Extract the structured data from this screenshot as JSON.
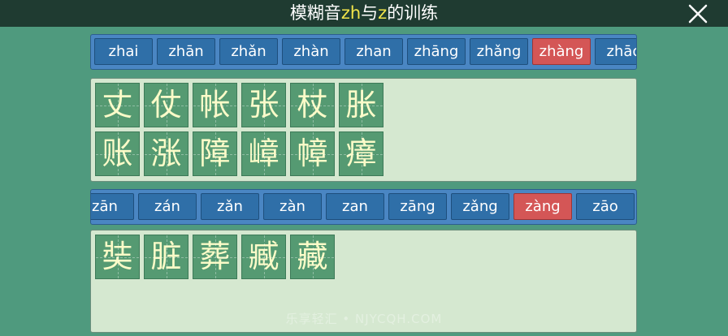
{
  "header": {
    "title_part1": "模糊音",
    "title_hl1": "zh",
    "title_part2": "与",
    "title_hl2": "z",
    "title_part3": "的训练",
    "close_icon": "close-x-icon"
  },
  "zh_pinyin": {
    "items": [
      "zhai",
      "zhān",
      "zhǎn",
      "zhàn",
      "zhan",
      "zhāng",
      "zhǎng",
      "zhàng",
      "zhāo"
    ],
    "active_index": 7
  },
  "zh_chars": [
    "丈",
    "仗",
    "帐",
    "张",
    "杖",
    "胀",
    "账",
    "涨",
    "障",
    "嶂",
    "幛",
    "瘴"
  ],
  "z_pinyin": {
    "items": [
      "zān",
      "zán",
      "zǎn",
      "zàn",
      "zan",
      "zāng",
      "zǎng",
      "zàng",
      "zāo"
    ],
    "active_index": 7
  },
  "z_chars": [
    "奘",
    "脏",
    "葬",
    "臧",
    "藏"
  ],
  "watermark": "乐享轻汇 • NJYCQH.COM",
  "colors": {
    "background": "#4f9a7e",
    "topbar": "#1f3b31",
    "highlight_text": "#f2e44a",
    "pinyin_button": "#2f6fa8",
    "pinyin_active": "#d45656",
    "panel": "#d5e8d0",
    "char_tile": "#559a72",
    "char_text": "#fbfbc8"
  }
}
